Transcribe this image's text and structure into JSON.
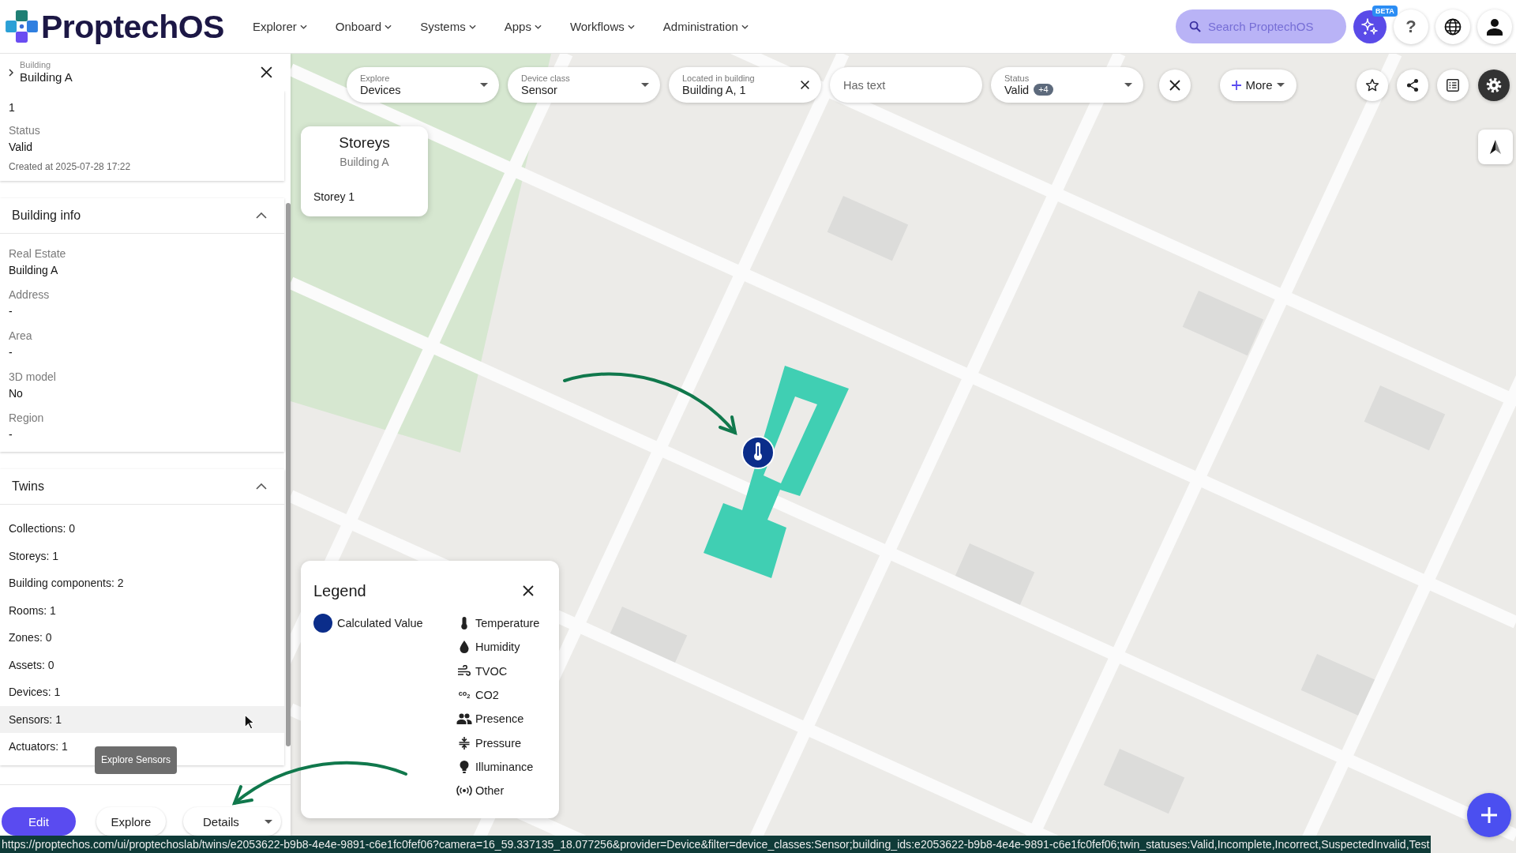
{
  "top_bar": {
    "logo": "ProptechOS",
    "nav": [
      {
        "label": "Explorer"
      },
      {
        "label": "Onboard"
      },
      {
        "label": "Systems"
      },
      {
        "label": "Apps"
      },
      {
        "label": "Workflows"
      },
      {
        "label": "Administration"
      }
    ],
    "search": {
      "placeholder": "Search ProptechOS"
    },
    "assistant_badge": "BETA",
    "help": "?"
  },
  "details_panel": {
    "breadcrumb": {
      "parent": "Building",
      "title": "Building A"
    },
    "summary": [
      {
        "value": "1"
      },
      {
        "label": "Status",
        "value": "Valid"
      }
    ],
    "created": "Created at 2025-07-28 17:22",
    "building_info": {
      "title": "Building info",
      "expanded": true,
      "fields": [
        {
          "label": "Real Estate",
          "value": "Building A"
        },
        {
          "label": "Address",
          "value": "-"
        },
        {
          "label": "Area",
          "value": "-"
        },
        {
          "label": "3D model",
          "value": "No"
        },
        {
          "label": "Region",
          "value": "-"
        }
      ]
    },
    "twins": {
      "title": "Twins",
      "expanded": true,
      "rows": [
        {
          "label": "Collections: 0",
          "highlighted": false
        },
        {
          "label": "Storeys: 1",
          "highlighted": false
        },
        {
          "label": "Building components: 2",
          "highlighted": false
        },
        {
          "label": "Rooms: 1",
          "highlighted": false
        },
        {
          "label": "Zones: 0",
          "highlighted": false
        },
        {
          "label": "Assets: 0",
          "highlighted": false
        },
        {
          "label": "Devices: 1",
          "highlighted": false
        },
        {
          "label": "Sensors: 1",
          "highlighted": true
        },
        {
          "label": "Actuators: 1",
          "highlighted": false
        }
      ]
    },
    "tooltip": "Explore Sensors",
    "actions": [
      {
        "label": "Edit",
        "kind": "primary"
      },
      {
        "label": "Explore",
        "kind": "secondary"
      },
      {
        "label": "Details",
        "kind": "menu"
      }
    ]
  },
  "map": {
    "filters": [
      {
        "kind": "select",
        "label": "Explore",
        "value": "Devices"
      },
      {
        "kind": "select",
        "label": "Device class",
        "value": "Sensor"
      },
      {
        "kind": "clearable",
        "label": "Located in building",
        "value": "Building A, 1"
      },
      {
        "kind": "text",
        "placeholder": "Has text"
      },
      {
        "kind": "select",
        "label": "Status",
        "value": "Valid",
        "count": "+4"
      }
    ],
    "more": "More",
    "storeys": {
      "title": "Storeys",
      "subtitle": "Building A",
      "items": [
        {
          "label": "Storey 1"
        }
      ]
    },
    "legend": {
      "title": "Legend",
      "calculated_value": "Calculated Value",
      "items": [
        {
          "kind": "temperature",
          "label": "Temperature"
        },
        {
          "kind": "humidity",
          "label": "Humidity"
        },
        {
          "kind": "tvoc",
          "label": "TVOC"
        },
        {
          "kind": "co2",
          "label": "CO2",
          "glyph": "co$_{2}$"
        },
        {
          "kind": "presence",
          "label": "Presence"
        },
        {
          "kind": "pressure",
          "label": "Pressure"
        },
        {
          "kind": "illuminance",
          "label": "Illuminance"
        },
        {
          "kind": "other",
          "label": "Other"
        }
      ]
    }
  },
  "status_bar": {
    "url": "https://proptechos.com/ui/proptechoslab/twins/e2053622-b9b8-4e4e-9891-c6e1fc0fef06?camera=16_59.337135_18.077256&provider=Device&filter=device_classes:Sensor;building_ids:e2053622-b9b8-4e4e-9891-c6e1fc0fef06;twin_statuses:Valid,Incomplete,Incorrect,SuspectedInvalid,Test"
  }
}
